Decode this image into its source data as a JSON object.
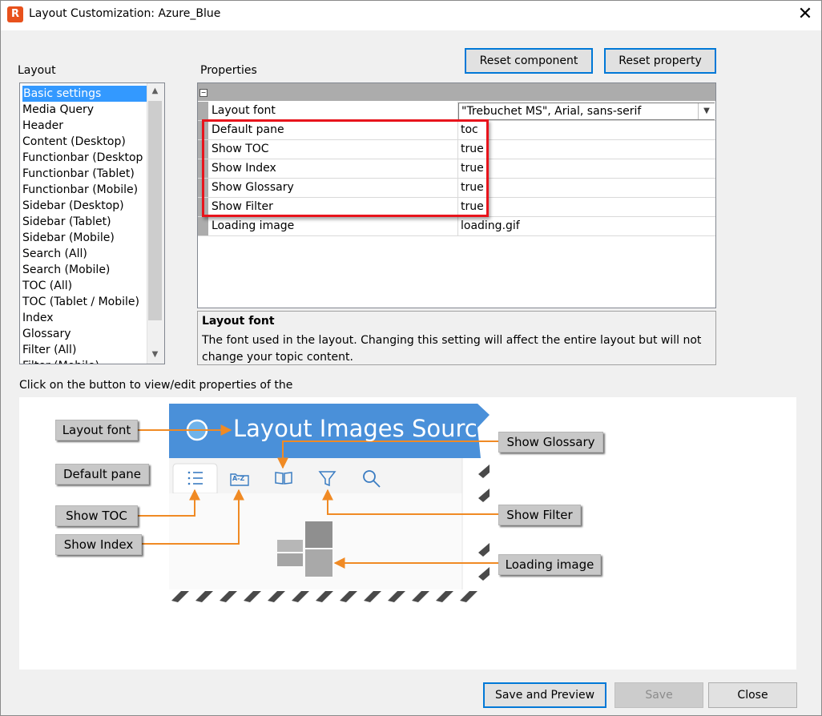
{
  "window": {
    "title": "Layout Customization: Azure_Blue",
    "close_glyph": "✕",
    "app_icon_glyph": "R"
  },
  "layout_panel": {
    "label": "Layout",
    "items": [
      {
        "label": "Basic settings",
        "selected": true
      },
      {
        "label": "Media Query"
      },
      {
        "label": "Header"
      },
      {
        "label": "Content (Desktop)"
      },
      {
        "label": "Functionbar (Desktop"
      },
      {
        "label": "Functionbar (Tablet)"
      },
      {
        "label": "Functionbar (Mobile)"
      },
      {
        "label": "Sidebar (Desktop)"
      },
      {
        "label": "Sidebar (Tablet)"
      },
      {
        "label": "Sidebar (Mobile)"
      },
      {
        "label": "Search (All)"
      },
      {
        "label": "Search (Mobile)"
      },
      {
        "label": "TOC (All)"
      },
      {
        "label": "TOC (Tablet / Mobile)"
      },
      {
        "label": "Index"
      },
      {
        "label": "Glossary"
      },
      {
        "label": "Filter (All)"
      },
      {
        "label": "Filter (Mobile)"
      }
    ]
  },
  "properties_panel": {
    "label": "Properties",
    "reset_component": "Reset component",
    "reset_property": "Reset property",
    "rows": [
      {
        "name": "Layout font",
        "value": "\"Trebuchet MS\", Arial, sans-serif"
      },
      {
        "name": "Default pane",
        "value": "toc"
      },
      {
        "name": "Show TOC",
        "value": "true"
      },
      {
        "name": "Show Index",
        "value": "true"
      },
      {
        "name": "Show Glossary",
        "value": "true"
      },
      {
        "name": "Show Filter",
        "value": "true"
      },
      {
        "name": "Loading image",
        "value": "loading.gif"
      }
    ],
    "description": {
      "title": "Layout font",
      "text": "The font used in the layout. Changing this setting will affect the entire layout but will not change your topic content."
    }
  },
  "preview": {
    "instruction": "Click on the button to view/edit properties of the",
    "header_text": "Layout Images Source",
    "header_color": "#4a90d9",
    "accent_color": "#f08a24",
    "callouts": {
      "layout_font": "Layout font",
      "default_pane": "Default pane",
      "show_toc": "Show TOC",
      "show_index": "Show Index",
      "show_glossary": "Show Glossary",
      "show_filter": "Show Filter",
      "loading_image": "Loading image"
    },
    "tab_icons": [
      "list-icon",
      "az-index-icon",
      "book-icon",
      "filter-icon",
      "search-icon"
    ],
    "az_label": "A-Z"
  },
  "footer": {
    "save_preview": "Save and Preview",
    "save": "Save",
    "close": "Close"
  },
  "colors": {
    "selection": "#3399ff",
    "highlight": "#e8141c",
    "focus_border": "#0078d7"
  }
}
